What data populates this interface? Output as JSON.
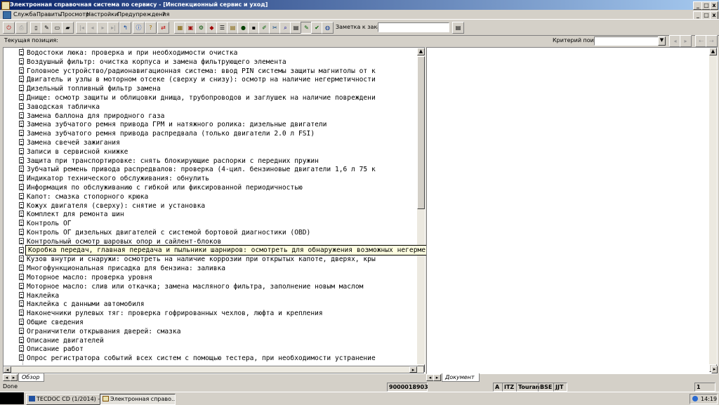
{
  "window": {
    "title": "Электронная справочная система по сервису - [Инспекционный сервис и уход]",
    "controls": [
      "_",
      "□",
      "x"
    ],
    "mdi_controls": [
      "_",
      "□",
      "x"
    ]
  },
  "menu": [
    "Служба",
    "Править",
    "Просмотр",
    "Настройки",
    "Предупреждения",
    "?"
  ],
  "toolbar": {
    "note_label": "Заметка к заказу:",
    "note_value": ""
  },
  "position_bar": {
    "current_position_label": "Текущая позиция:",
    "search_criteria_label": "Критерий поиска:",
    "search_value": ""
  },
  "tree": {
    "items": [
      "Водостоки люка: проверка и при необходимости очистка",
      "Воздушный фильтр: очистка корпуса и замена фильтрующего элемента",
      "Головное устройство/радионавигационная система: ввод PIN системы защиты магнитолы от к",
      "Двигатель и узлы в моторном отсеке (сверху и снизу): осмотр на наличие негерметичности",
      "Дизельный топливный фильтр замена",
      "Днище: осмотр защиты и облицовки днища, трубопроводов и заглушек на наличие повреждени",
      "Заводская табличка",
      "Замена баллона для природного газа",
      "Замена зубчатого ремня привода ГРМ и натяжного ролика: дизельные двигатели",
      "Замена зубчатого ремня привода распредвала (только двигатели 2.0 л FSI)",
      "Замена свечей зажигания",
      "Записи в сервисной книжке",
      "Защита при транспортировке: снять блокирующие распорки с передних пружин",
      "Зубчатый ремень привода распредвалов: проверка (4-цил. бензиновые двигатели 1,6 л 75 к",
      "Индикатор технического обслуживания: обнулить",
      "Информация по обслуживанию с гибкой или фиксированной периодичностью",
      "Капот: смазка стопорного крюка",
      "Кожух двигателя (сверху): снятие и установка",
      "Комплект для ремонта шин",
      "Контроль ОГ",
      "Контроль ОГ дизельных двигателей с системой бортовой диагностики (OBD)",
      "Контрольный осмотр шаровых опор и сайлент-блоков",
      "Коробка передач, главная передача и пыльники шарниров: осмотреть для обнаружения возмо",
      "Кузов внутри и снаружи: осмотреть на наличие коррозии при открытых капоте, дверях, кры",
      "Многофункциональная присадка для бензина: заливка",
      "Моторное масло: проверка уровня",
      "Моторное масло: слив или откачка; замена масляного фильтра, заполнение новым маслом",
      "Наклейка",
      "Наклейка с данными автомобиля",
      "Наконечники рулевых тяг: проверка гофрированных чехлов, люфта и крепления",
      "Общие сведения",
      "Ограничители открывания дверей: смазка",
      "Описание двигателей",
      "Описание работ",
      "Опрос регистратора событий всех систем с помощью тестера, при необходимости устранение"
    ],
    "tooltip": "Коробка передач, главная передача и пыльники шарниров: осмотреть для обнаружения возможных негерметичностей и повреждений"
  },
  "tabs": {
    "left": "Обзор",
    "right": "Документ"
  },
  "status": {
    "left": "Done",
    "order_number": "9000018903",
    "fields": [
      "A",
      "ITZ",
      "Touran",
      "BSE",
      "JJT"
    ],
    "page": "1"
  },
  "taskbar": {
    "buttons": [
      "TECDOC CD (1/2014) - ...",
      "Электронная справо..."
    ],
    "clock": "14:19"
  }
}
